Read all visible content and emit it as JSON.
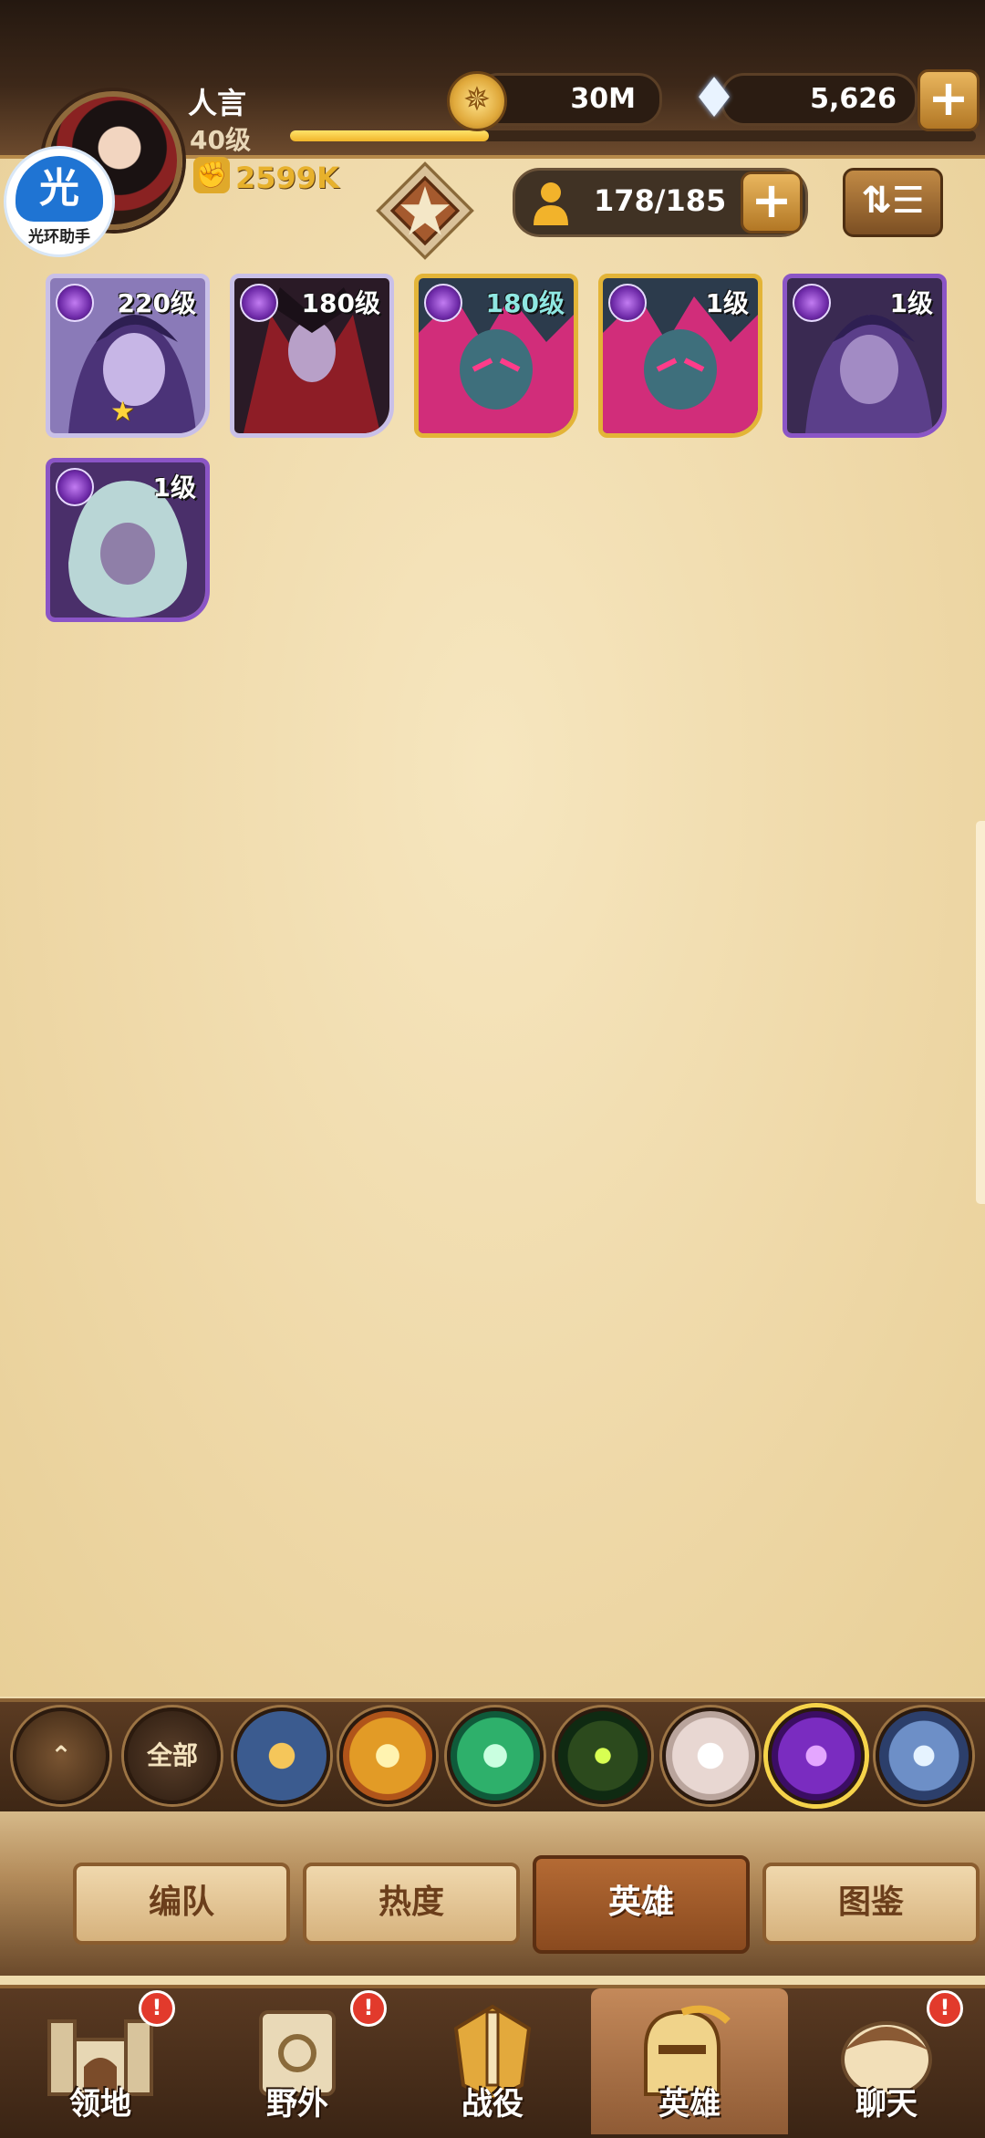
{
  "player": {
    "name": "人言",
    "level": "40级",
    "power": "2599K",
    "xp_fraction": 0.29
  },
  "resources": {
    "gold": "30M",
    "diamonds": "5,626"
  },
  "heroes_count": "178/185",
  "badge": {
    "glyph": "光",
    "caption": "光环助手"
  },
  "hero_cards": [
    {
      "level": "220级",
      "faction": "shadow",
      "border": "silver",
      "stars": 1
    },
    {
      "level": "180级",
      "faction": "shadow",
      "border": "silver",
      "stars": 0
    },
    {
      "level": "180级",
      "faction": "shadow",
      "border": "gold",
      "stars": 0
    },
    {
      "level": "1级",
      "faction": "shadow",
      "border": "gold",
      "stars": 0
    },
    {
      "level": "1级",
      "faction": "shadow",
      "border": "purple",
      "stars": 0
    },
    {
      "level": "1级",
      "faction": "shadow",
      "border": "purple",
      "stars": 0
    }
  ],
  "faction_filters": {
    "all_label": "全部",
    "selected": "graveborn"
  },
  "sub_tabs": [
    "编队",
    "热度",
    "英雄",
    "图鉴"
  ],
  "active_sub_tab": "英雄",
  "bottom_nav": [
    "领地",
    "野外",
    "战役",
    "英雄",
    "聊天"
  ],
  "active_nav": "英雄",
  "alert_glyph": "!",
  "colors": {
    "gold_text": "#e7b12c",
    "alert_red": "#e23a2c",
    "parchment": "#efd9a9"
  }
}
